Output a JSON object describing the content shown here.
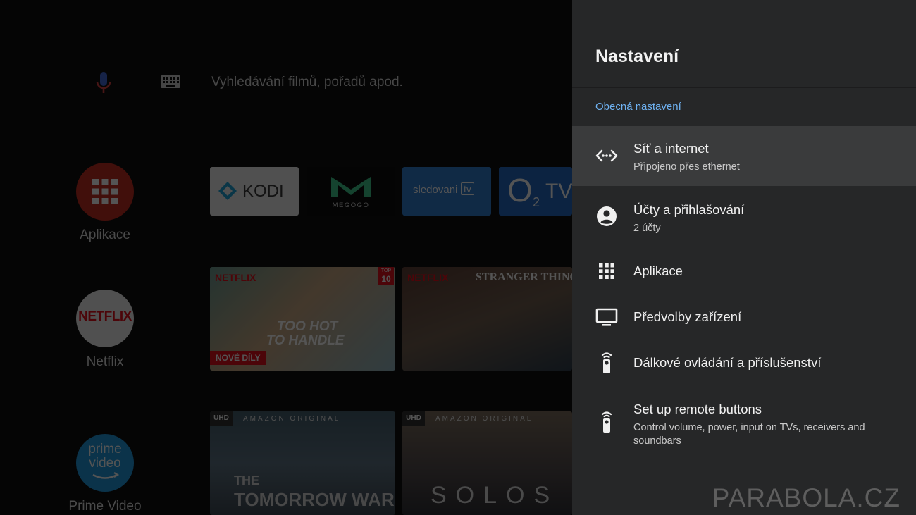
{
  "home": {
    "search_hint": "Vyhledávání filmů, pořadů apod.",
    "sidebar": [
      {
        "label": "Aplikace"
      },
      {
        "label": "Netflix",
        "logo": "NETFLIX"
      },
      {
        "label": "Prime Video",
        "logo_line1": "prime",
        "logo_line2": "video"
      }
    ],
    "apps": [
      {
        "name": "KODI"
      },
      {
        "name": "MEGOGO"
      },
      {
        "name": "sledovani",
        "suffix": "tv"
      },
      {
        "name": "O",
        "sub": "2",
        "suffix": "TV"
      }
    ],
    "netflix_row": [
      {
        "brand": "NETFLIX",
        "badge_top": "TOP",
        "badge_num": "10",
        "title_line1": "TOO HOT",
        "title_line2": "TO HANDLE",
        "ribbon": "NOVÉ DÍLY"
      },
      {
        "brand": "NETFLIX",
        "title": "STRANGER THINGS"
      }
    ],
    "prime_row": [
      {
        "badge": "UHD",
        "header": "AMAZON ORIGINAL",
        "title_line1": "THE",
        "title_line2": "TOMORROW WAR"
      },
      {
        "badge": "UHD",
        "header": "AMAZON ORIGINAL",
        "title": "SOLOS"
      }
    ]
  },
  "settings": {
    "title": "Nastavení",
    "section": "Obecná nastavení",
    "items": [
      {
        "title": "Síť a internet",
        "subtitle": "Připojeno přes ethernet",
        "icon": "network-icon"
      },
      {
        "title": "Účty a přihlašování",
        "subtitle": "2 účty",
        "icon": "account-icon"
      },
      {
        "title": "Aplikace",
        "icon": "apps-grid-icon"
      },
      {
        "title": "Předvolby zařízení",
        "icon": "tv-icon"
      },
      {
        "title": "Dálkové ovládání a příslušenství",
        "icon": "remote-icon"
      },
      {
        "title": "Set up remote buttons",
        "subtitle": "Control volume, power, input on TVs, receivers and soundbars",
        "icon": "remote-icon"
      }
    ]
  },
  "watermark": "PARABOLA.CZ",
  "colors": {
    "panel_bg": "#262728",
    "selected_row": "#3a3b3c",
    "section_accent": "#6fb2f2",
    "apps_red": "#c3281b",
    "netflix_red": "#e50914",
    "prime_blue": "#1b98e0"
  }
}
